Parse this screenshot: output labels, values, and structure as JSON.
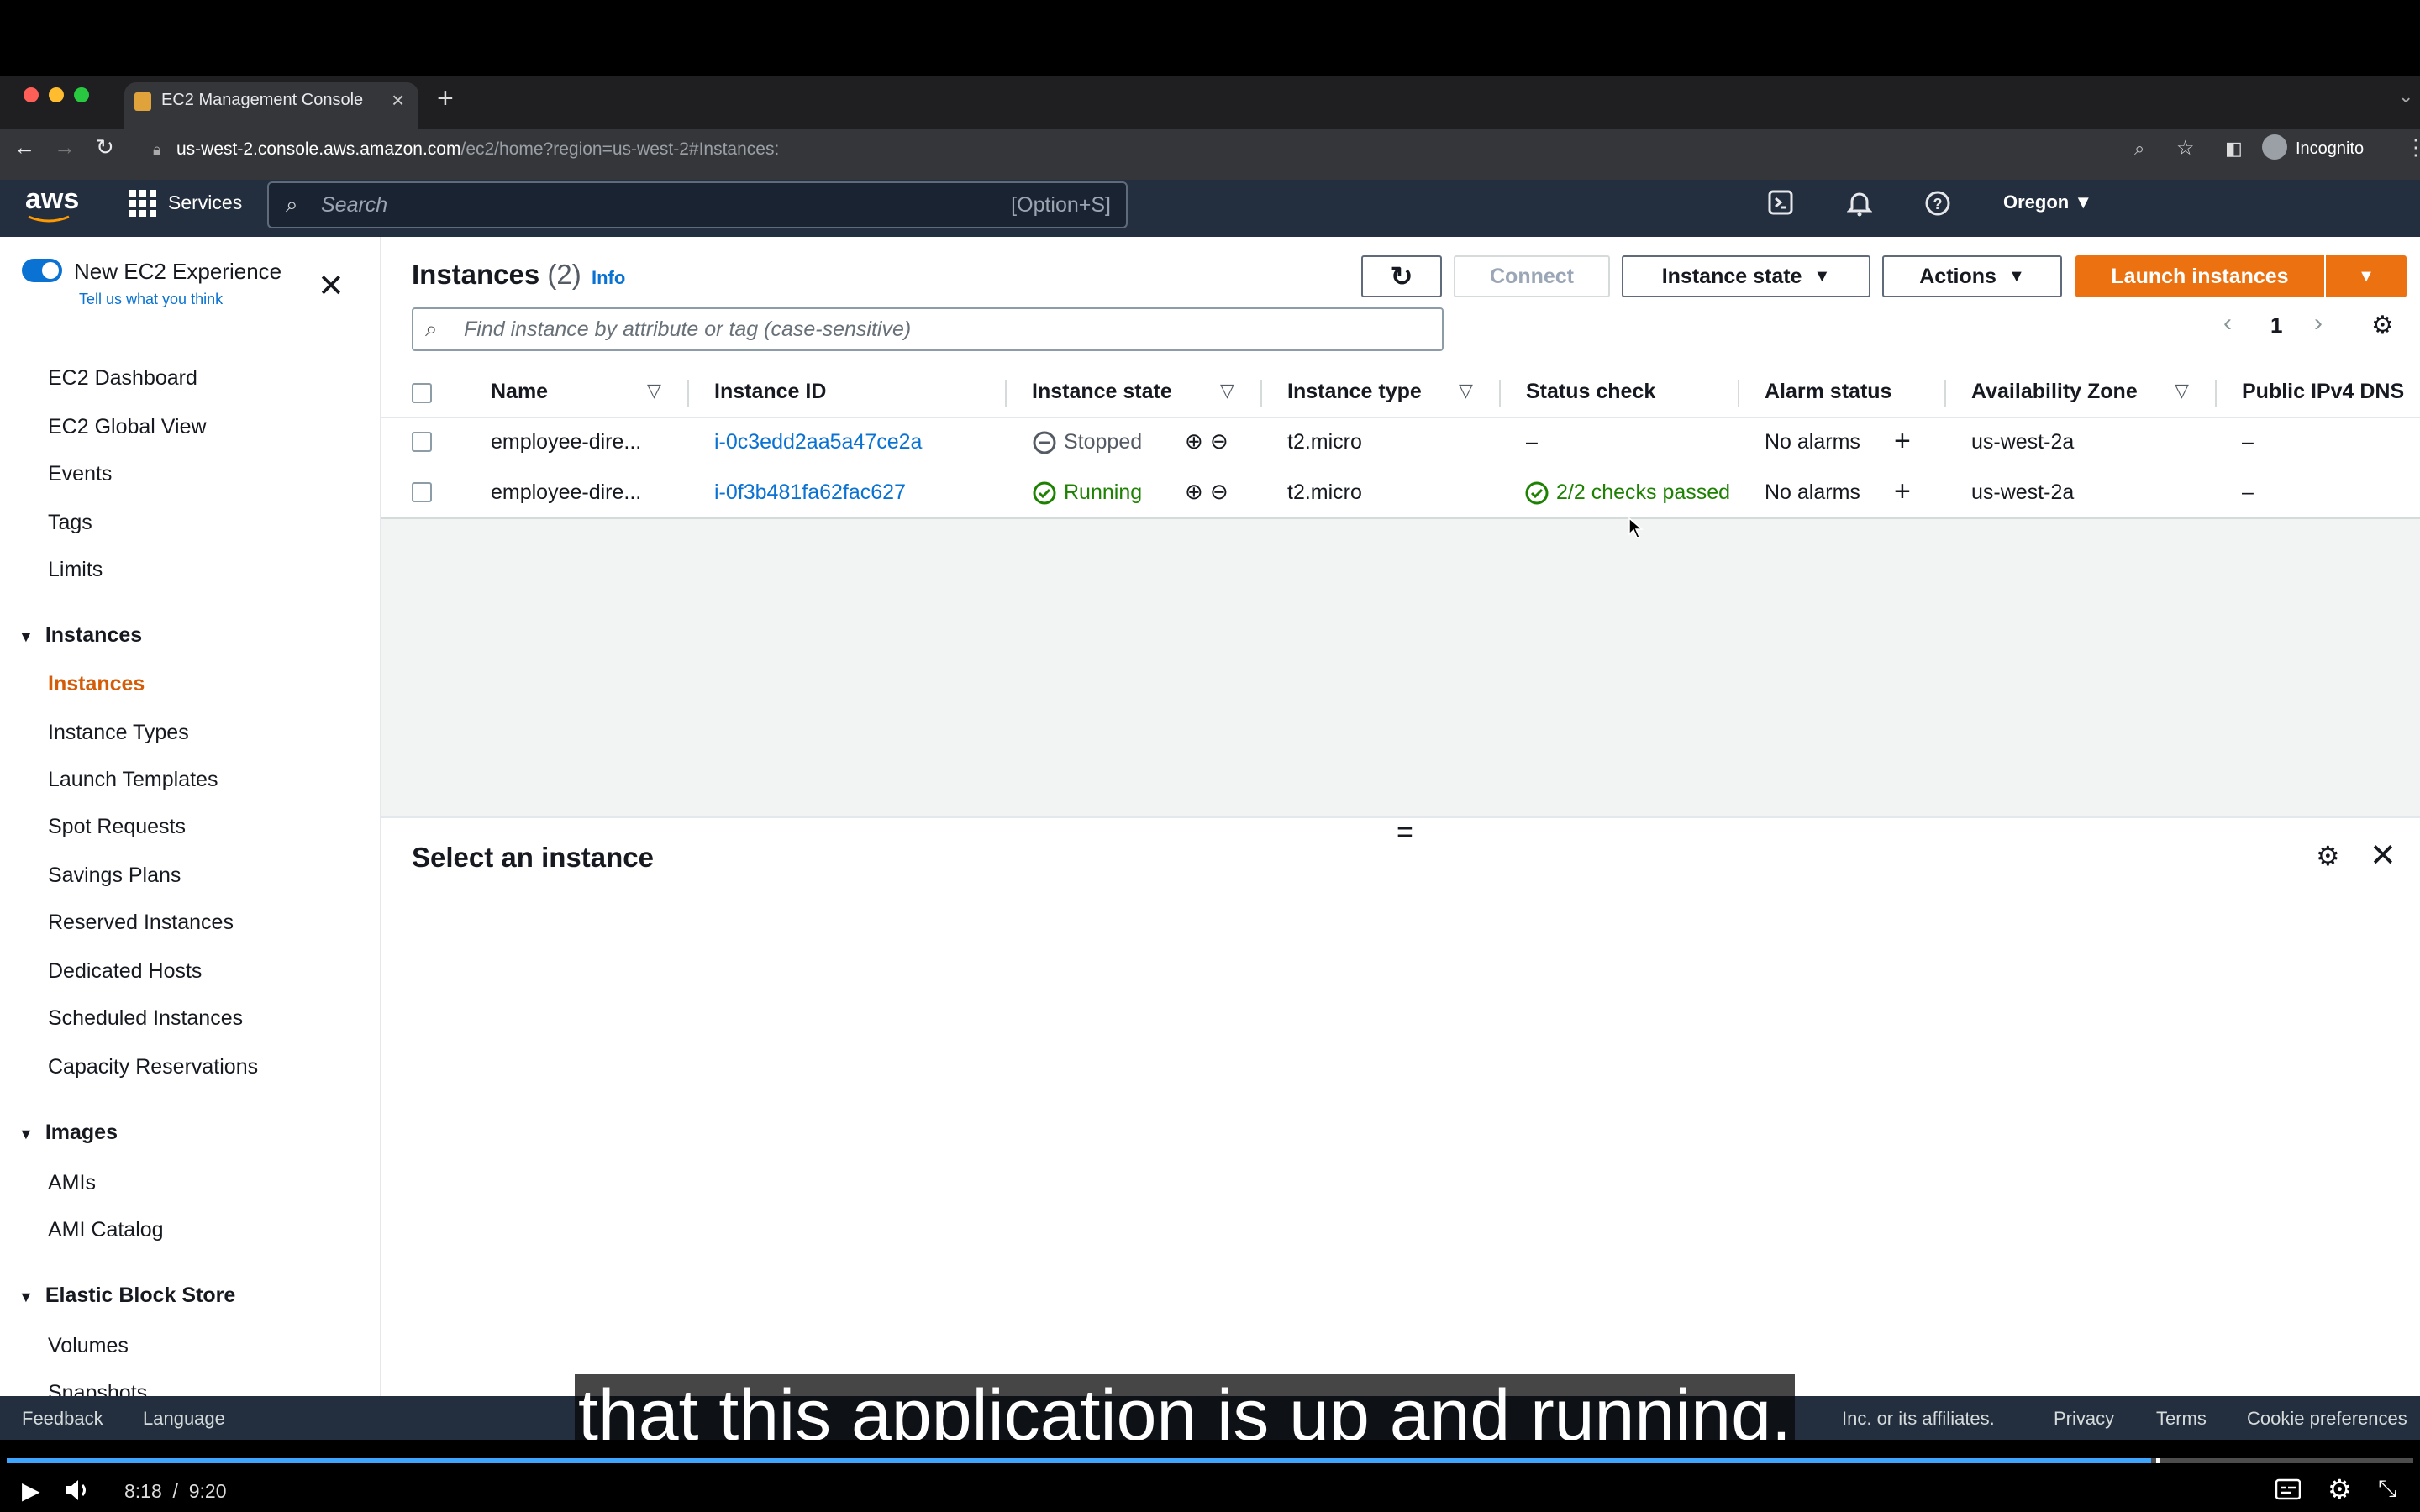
{
  "browser": {
    "tab_title": "EC2 Management Console",
    "url_host": "us-west-2.console.aws.amazon.com",
    "url_path": "/ec2/home?region=us-west-2#Instances:",
    "profile": "Incognito"
  },
  "aws_header": {
    "logo": "aws",
    "services_label": "Services",
    "search_placeholder": "Search",
    "search_shortcut": "[Option+S]",
    "region": "Oregon ▼"
  },
  "sidebar": {
    "new_experience_label": "New EC2 Experience",
    "tell_us_label": "Tell us what you think",
    "items": [
      "EC2 Dashboard",
      "EC2 Global View",
      "Events",
      "Tags",
      "Limits"
    ],
    "sections": [
      {
        "title": "Instances",
        "items": [
          "Instances",
          "Instance Types",
          "Launch Templates",
          "Spot Requests",
          "Savings Plans",
          "Reserved Instances",
          "Dedicated Hosts",
          "Scheduled Instances",
          "Capacity Reservations"
        ],
        "active": "Instances"
      },
      {
        "title": "Images",
        "items": [
          "AMIs",
          "AMI Catalog"
        ]
      },
      {
        "title": "Elastic Block Store",
        "items": [
          "Volumes",
          "Snapshots"
        ]
      }
    ]
  },
  "main": {
    "title": "Instances",
    "count": "(2)",
    "info_label": "Info",
    "buttons": {
      "connect": "Connect",
      "instance_state": "Instance state",
      "actions": "Actions",
      "launch": "Launch instances"
    },
    "search_placeholder": "Find instance by attribute or tag (case-sensitive)",
    "page_number": "1",
    "columns": [
      "Name",
      "Instance ID",
      "Instance state",
      "Instance type",
      "Status check",
      "Alarm status",
      "Availability Zone",
      "Public IPv4 DNS"
    ],
    "rows": [
      {
        "name": "employee-dire...",
        "id": "i-0c3edd2aa5a47ce2a",
        "state": "Stopped",
        "type": "t2.micro",
        "status": "–",
        "alarm": "No alarms",
        "az": "us-west-2a",
        "dns": "–"
      },
      {
        "name": "employee-dire...",
        "id": "i-0f3b481fa62fac627",
        "state": "Running",
        "type": "t2.micro",
        "status": "2/2 checks passed",
        "alarm": "No alarms",
        "az": "us-west-2a",
        "dns": "–"
      }
    ],
    "select_title": "Select an instance"
  },
  "footer": {
    "feedback": "Feedback",
    "language": "Language",
    "copyright": "Inc. or its affiliates.",
    "privacy": "Privacy",
    "terms": "Terms",
    "cookies": "Cookie preferences"
  },
  "video": {
    "subtitle": "that this application is up and running.",
    "current_time": "8:18",
    "duration": "9:20",
    "time_display": "8:18  /  9:20",
    "progress_fraction": 0.891
  },
  "colors": {
    "aws_nav": "#232f3e",
    "launch_orange": "#ec7211",
    "link_blue": "#0972d3",
    "running_green": "#1d8102",
    "active_nav": "#d45b07"
  }
}
